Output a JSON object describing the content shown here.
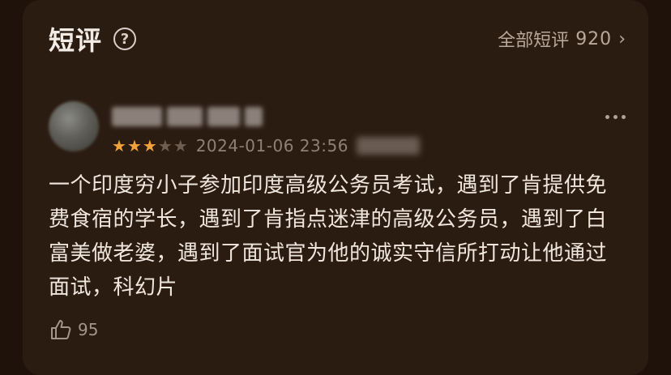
{
  "header": {
    "title": "短评",
    "help_icon_glyph": "?",
    "all_reviews_label": "全部短评",
    "all_reviews_count": "920",
    "chevron": "›"
  },
  "review": {
    "rating": 3,
    "max_rating": 5,
    "date": "2024-01-06 23:56",
    "content": "一个印度穷小子参加印度高级公务员考试，遇到了肯提供免费食宿的学长，遇到了肯指点迷津的高级公务员，遇到了白富美做老婆，遇到了面试官为他的诚实守信所打动让他通过面试，科幻片",
    "likes": "95"
  },
  "colors": {
    "background": "#1f120b",
    "card": "#2b1c12",
    "star_active": "#f2a23a",
    "star_inactive": "#6e5e52"
  },
  "icons": {
    "help": "question-circle-icon",
    "more": "more-dots-icon",
    "like": "thumbs-up-icon",
    "chevron": "chevron-right-icon"
  }
}
